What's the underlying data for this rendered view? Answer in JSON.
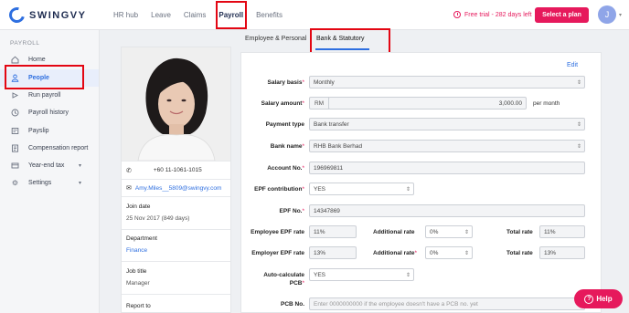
{
  "app": {
    "logo_text": "SWINGVY",
    "brand_color": "#2e6fe0",
    "accent_color": "#e6195c",
    "highlight_color": "#e30613"
  },
  "topnav": {
    "items": [
      "HR hub",
      "Leave",
      "Claims",
      "Payroll",
      "Benefits"
    ],
    "active": "Payroll"
  },
  "trial": {
    "text": "Free trial - 282 days left",
    "button": "Select a plan"
  },
  "user": {
    "avatar_initial": "J"
  },
  "sidebar": {
    "section": "PAYROLL",
    "items": [
      {
        "label": "Home",
        "icon": "home-icon"
      },
      {
        "label": "People",
        "icon": "person-icon",
        "active": true
      },
      {
        "label": "Run payroll",
        "icon": "run-payroll-icon"
      },
      {
        "label": "Payroll history",
        "icon": "history-icon"
      },
      {
        "label": "Payslip",
        "icon": "payslip-icon"
      },
      {
        "label": "Compensation report",
        "icon": "report-icon"
      },
      {
        "label": "Year-end tax",
        "icon": "tax-icon",
        "expandable": true
      },
      {
        "label": "Settings",
        "icon": "gear-icon",
        "expandable": true
      }
    ]
  },
  "profile": {
    "phone": "+60 11-1061-1015",
    "email": "Amy.Miles__5809@swingvy.com",
    "join_date_label": "Join date",
    "join_date": "25 Nov 2017 (849 days)",
    "department_label": "Department",
    "department": "Finance",
    "job_title_label": "Job title",
    "job_title": "Manager",
    "report_to_label": "Report to"
  },
  "tabs": {
    "employee": "Employee & Personal",
    "bank": "Bank & Statutory",
    "active": "Bank & Statutory"
  },
  "form": {
    "edit": "Edit",
    "salary_basis": {
      "label": "Salary basis",
      "value": "Monthly"
    },
    "salary_amount": {
      "label": "Salary amount",
      "currency": "RM",
      "value": "3,000.00",
      "suffix": "per month"
    },
    "payment_type": {
      "label": "Payment type",
      "value": "Bank transfer"
    },
    "bank_name": {
      "label": "Bank name",
      "value": "RHB Bank Berhad"
    },
    "account_no": {
      "label": "Account No.",
      "value": "196969811"
    },
    "epf_contribution": {
      "label": "EPF contribution",
      "value": "YES"
    },
    "epf_no": {
      "label": "EPF No.",
      "value": "14347869"
    },
    "employee_epf_rate": {
      "label": "Employee EPF rate",
      "value": "11%"
    },
    "employee_additional_rate": {
      "label": "Additional rate",
      "value": "0%"
    },
    "employee_total_rate": {
      "label": "Total rate",
      "value": "11%"
    },
    "employer_epf_rate": {
      "label": "Employer EPF rate",
      "value": "13%"
    },
    "employer_additional_rate": {
      "label": "Additional rate",
      "value": "0%"
    },
    "employer_total_rate": {
      "label": "Total rate",
      "value": "13%"
    },
    "auto_pcb": {
      "label_line1": "Auto-calculate",
      "label_line2": "PCB",
      "value": "YES"
    },
    "pcb_no": {
      "label": "PCB No.",
      "placeholder": "Enter 0000000000 if the employee doesn't have a PCB no. yet"
    }
  },
  "help": {
    "label": "Help"
  }
}
